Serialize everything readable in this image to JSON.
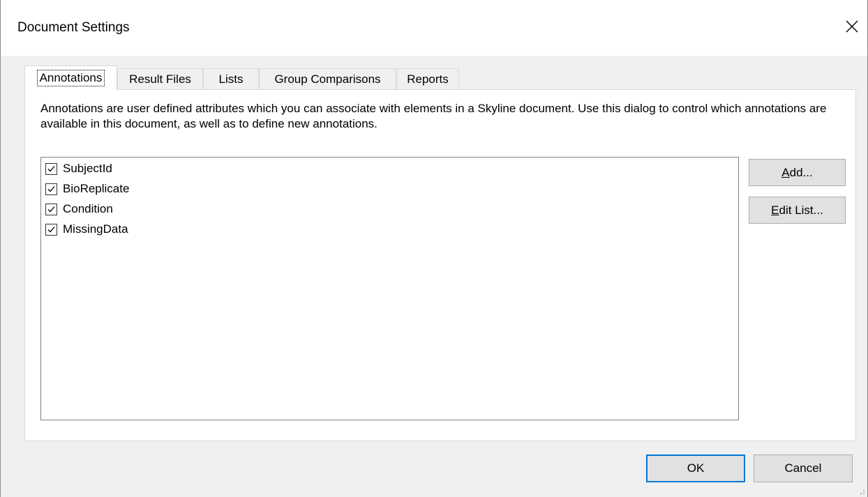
{
  "window": {
    "title": "Document Settings"
  },
  "tabs": [
    {
      "label": "Annotations",
      "active": true
    },
    {
      "label": "Result Files",
      "active": false
    },
    {
      "label": "Lists",
      "active": false
    },
    {
      "label": "Group Comparisons",
      "active": false
    },
    {
      "label": "Reports",
      "active": false
    }
  ],
  "annotations_tab": {
    "description": "Annotations are user defined attributes which you can associate with elements in a Skyline document. Use this dialog to control which annotations are available in this document, as well as to define new annotations.",
    "items": [
      {
        "label": "SubjectId",
        "checked": true
      },
      {
        "label": "BioReplicate",
        "checked": true
      },
      {
        "label": "Condition",
        "checked": true
      },
      {
        "label": "MissingData",
        "checked": true
      }
    ],
    "add_button": {
      "mnemonic": "A",
      "rest": "dd..."
    },
    "edit_list_button": {
      "mnemonic": "E",
      "rest": "dit List..."
    }
  },
  "footer": {
    "ok_label": "OK",
    "cancel_label": "Cancel"
  },
  "icons": {
    "close": "close-icon",
    "checkmark": "checkmark-icon",
    "resize_grip": "resize-grip-icon"
  },
  "colors": {
    "focus_border": "#0078d7",
    "button_face": "#e1e1e1",
    "dialog_background": "#f0f0f0"
  }
}
